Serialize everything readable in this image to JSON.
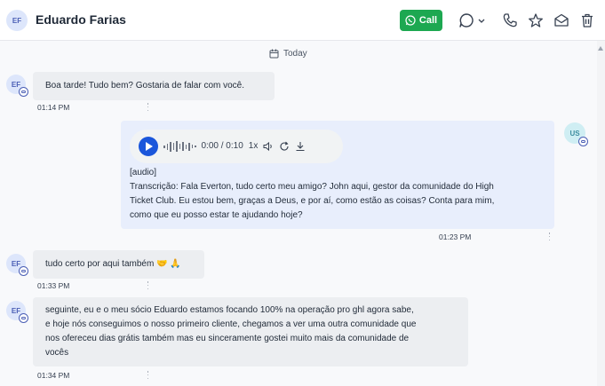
{
  "header": {
    "avatar_initials": "EF",
    "contact_name": "Eduardo Farias",
    "call_label": "Call",
    "icons": [
      "comment-dropdown-icon",
      "chevron-down-icon",
      "phone-icon",
      "star-icon",
      "envelope-open-icon",
      "trash-icon"
    ]
  },
  "date_separator": "Today",
  "messages": [
    {
      "direction": "in",
      "avatar": "EF",
      "text": "Boa tarde! Tudo bem? Gostaria de falar com você.",
      "time": "01:14 PM"
    },
    {
      "direction": "out",
      "avatar": "US",
      "audio": {
        "time": "0:00 / 0:10",
        "speed": "1x"
      },
      "tag": "[audio]",
      "lines": [
        "Transcrição: Fala Everton, tudo certo meu amigo? John aqui, gestor da comunidade do High",
        "Ticket Club. Eu estou bem, graças a Deus, e por aí, como estão as coisas? Conta para mim,",
        "como que eu posso estar te ajudando hoje?"
      ],
      "time": "01:23 PM"
    },
    {
      "direction": "in",
      "avatar": "EF",
      "text": "tudo certo por aqui também 🤝 🙏",
      "time": "01:33 PM"
    },
    {
      "direction": "in",
      "avatar": "EF",
      "lines": [
        "seguinte, eu e o meu sócio Eduardo estamos focando 100% na operação pro ghl agora sabe,",
        "e hoje nós conseguimos o nosso primeiro cliente, chegamos a ver uma outra comunidade que",
        "nos ofereceu dias grátis também mas eu sinceramente gostei muito mais da comunidade de",
        "vocês"
      ],
      "time": "01:34 PM"
    }
  ],
  "colors": {
    "accent": "#1a56db",
    "call": "#1da851",
    "in_bubble": "#eceef1",
    "out_bubble": "#e8eefc"
  }
}
